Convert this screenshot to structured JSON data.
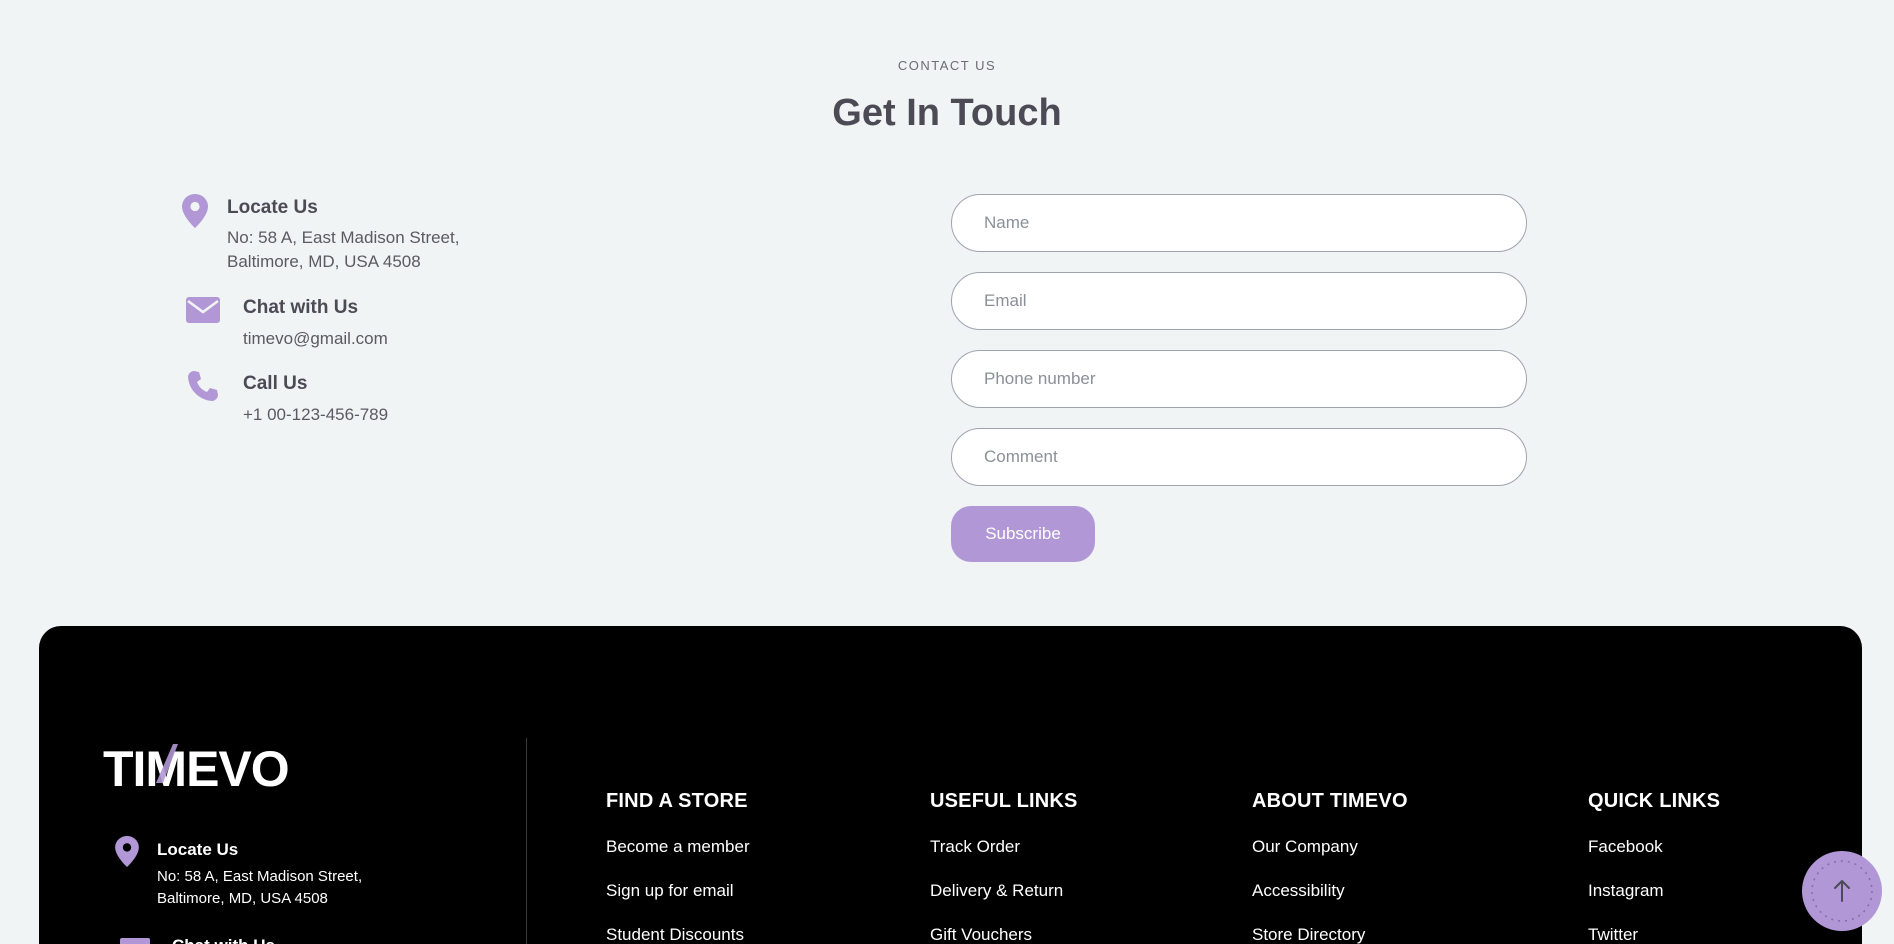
{
  "contact": {
    "eyebrow": "CONTACT US",
    "heading": "Get In Touch",
    "locate": {
      "title": "Locate Us",
      "line1": "No: 58 A, East Madison Street,",
      "line2": "Baltimore, MD, USA 4508"
    },
    "chat": {
      "title": "Chat with Us",
      "text": "timevo@gmail.com"
    },
    "call": {
      "title": "Call Us",
      "text": "+1 00-123-456-789"
    }
  },
  "form": {
    "name_placeholder": "Name",
    "email_placeholder": "Email",
    "phone_placeholder": "Phone number",
    "comment_placeholder": "Comment",
    "submit_label": "Subscribe"
  },
  "footer": {
    "logo_text": "TIMEVO",
    "locate": {
      "title": "Locate Us",
      "line1": "No: 58 A, East Madison Street,",
      "line2": "Baltimore, MD, USA 4508"
    },
    "chat_title": "Chat with Us",
    "columns": [
      {
        "title": "FIND A STORE",
        "links": [
          "Become a member",
          "Sign up for email",
          "Student Discounts"
        ]
      },
      {
        "title": "USEFUL LINKS",
        "links": [
          "Track Order",
          "Delivery & Return",
          "Gift Vouchers"
        ]
      },
      {
        "title": "ABOUT TIMEVO",
        "links": [
          "Our Company",
          "Accessibility",
          "Store Directory"
        ]
      },
      {
        "title": "QUICK LINKS",
        "links": [
          "Facebook",
          "Instagram",
          "Twitter"
        ]
      }
    ]
  },
  "icons": {
    "location": "map-pin-icon",
    "mail": "envelope-icon",
    "phone": "phone-icon",
    "scroll_top": "arrow-up-icon"
  },
  "colors": {
    "accent": "#b197d6",
    "background": "#f0f4f5",
    "footer": "#000000",
    "heading": "#4b4a55"
  }
}
